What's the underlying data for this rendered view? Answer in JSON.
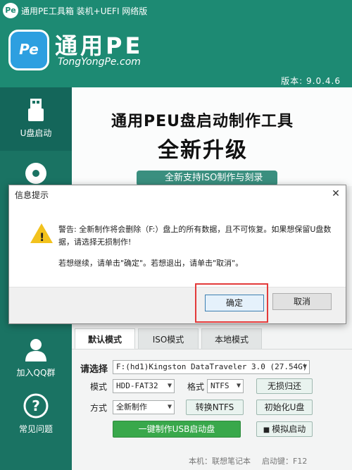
{
  "titlebar": {
    "icon_text": "Pe",
    "title": "通用PE工具箱 装机+UEFI 网络版"
  },
  "header": {
    "logo_text": "Pe",
    "logo_title": "通用PE",
    "logo_subtitle": "TongYongPe.com",
    "version": "版本: 9.0.4.6"
  },
  "sidebar": {
    "items": [
      {
        "label": "U盘启动",
        "icon": "usb-drive-icon"
      },
      {
        "label": "",
        "icon": "disc-icon"
      },
      {
        "label": "加入QQ群",
        "icon": "user-icon"
      },
      {
        "label": "常见问题",
        "icon": "question-icon"
      }
    ]
  },
  "banner": {
    "line1": "通用PEU盘启动制作工具",
    "line2": "全新升级",
    "feature": "全新支持ISO制作与刻录"
  },
  "tabs": [
    {
      "label": "默认模式"
    },
    {
      "label": "ISO模式"
    },
    {
      "label": "本地模式"
    }
  ],
  "form": {
    "select_label": "请选择",
    "device_value": "F:(hd1)Kingston DataTraveler 3.0 (27.54G)",
    "mode_label": "模式",
    "mode_value": "HDD-FAT32",
    "format_label": "格式",
    "format_value": "NTFS",
    "lossless_button": "无损归还",
    "method_label": "方式",
    "method_value": "全新制作",
    "ntfs_button": "转换NTFS",
    "init_button": "初始化U盘",
    "make_button": "一键制作USB启动盘",
    "sim_button": "模拟启动"
  },
  "footer": {
    "machine": "本机：联想笔记本",
    "hotkey": "启动键：F12"
  },
  "dialog": {
    "title": "信息提示",
    "message1": "警告: 全新制作将会删除（F:）盘上的所有数据，且不可恢复。如果想保留U盘数据，请选择无损制作!",
    "message2": "若想继续，请单击\"确定\"。若想退出，请单击\"取消\"。",
    "ok_button": "确定",
    "cancel_button": "取消"
  },
  "colors": {
    "brand_green": "#1d8a73",
    "make_button_green": "#39a84b",
    "highlight_red": "#e33a3a",
    "warning_yellow": "#f2c21d"
  }
}
